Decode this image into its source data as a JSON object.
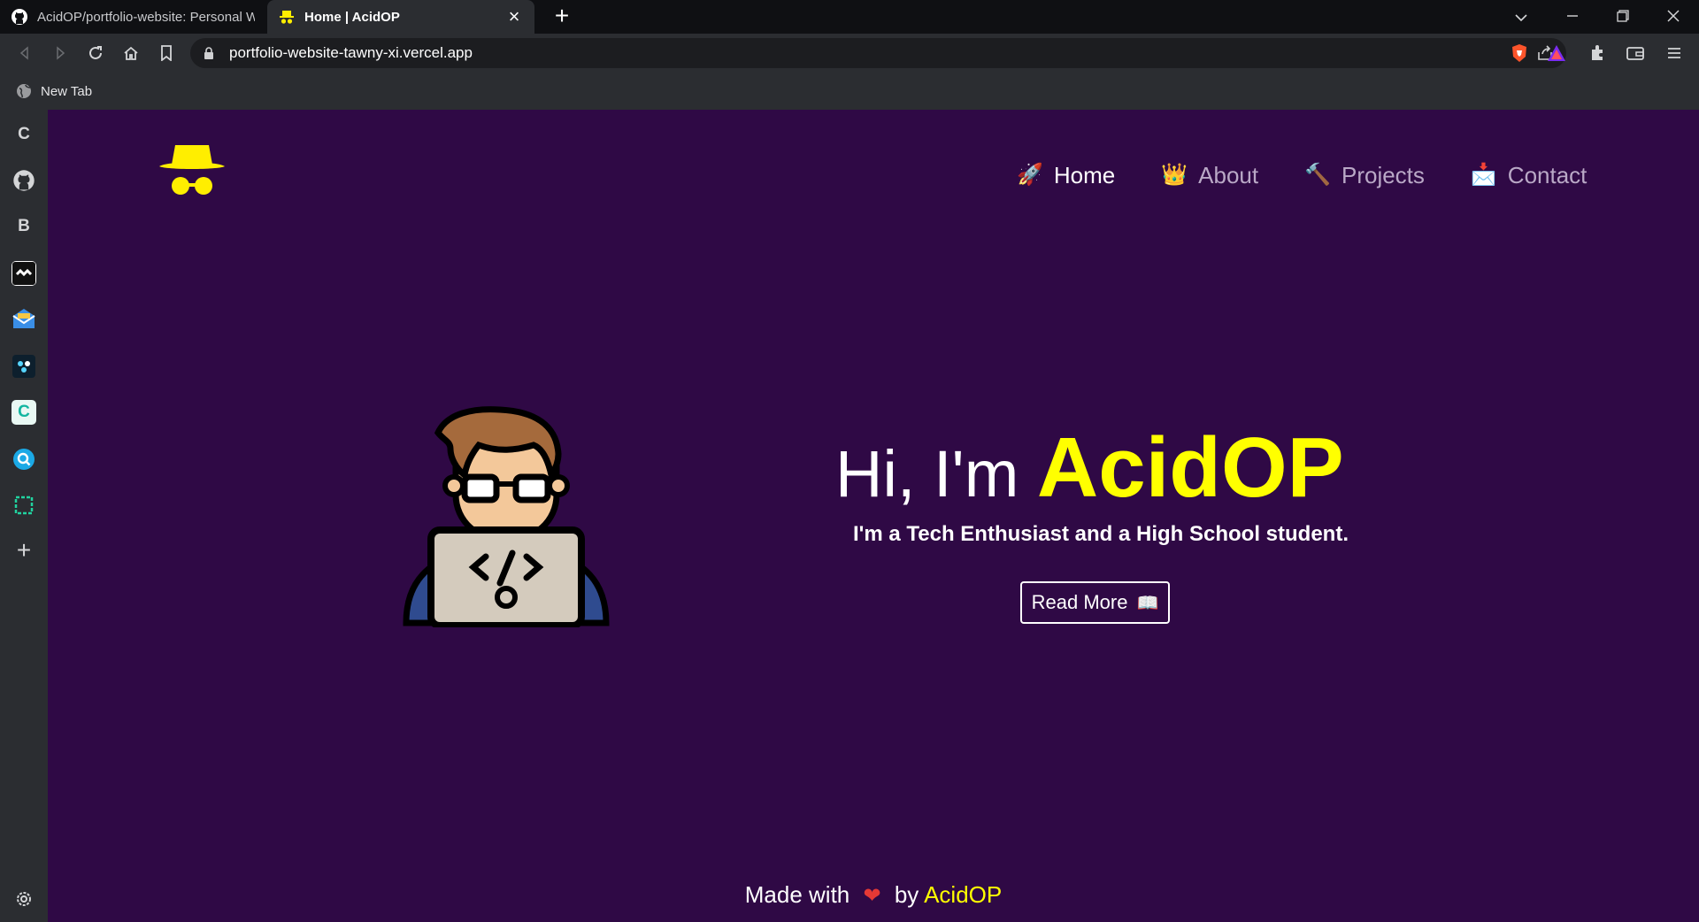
{
  "browser": {
    "tabs": [
      {
        "title": "AcidOP/portfolio-website: Personal W",
        "icon": "github-icon",
        "active": false
      },
      {
        "title": "Home | AcidOP",
        "icon": "spy-hat-icon",
        "active": true
      }
    ],
    "new_tab_label": "+",
    "window_controls": [
      "chevron-down-icon",
      "minimize-icon",
      "restore-icon",
      "close-icon"
    ],
    "address_bar": {
      "url": "portfolio-website-tawny-xi.vercel.app"
    },
    "bookmarks": [
      {
        "label": "New Tab"
      }
    ],
    "sidebar_icons": [
      "c-icon",
      "github-icon",
      "b-icon",
      "link-icon",
      "mail-icon",
      "puzzle-icon",
      "c-app-icon",
      "search-app-icon",
      "crop-icon",
      "plus-icon",
      "settings-icon"
    ],
    "colors": {
      "tabstrip": "#0f1013",
      "toolbar": "#2b2d31",
      "omnibox": "#1c1d20"
    }
  },
  "site": {
    "nav": [
      {
        "emoji": "🚀",
        "label": "Home",
        "active": true
      },
      {
        "emoji": "👑",
        "label": "About",
        "active": false
      },
      {
        "emoji": "🔨",
        "label": "Projects",
        "active": false
      },
      {
        "emoji": "📩",
        "label": "Contact",
        "active": false
      }
    ],
    "hero": {
      "greeting": "Hi, I'm",
      "name": "AcidOP",
      "subtitle": "I'm a Tech Enthusiast and a High School student.",
      "button_label": "Read More",
      "button_emoji": "📖"
    },
    "footer": {
      "made_with": "Made with",
      "heart": "❤",
      "by": "by",
      "brand": "AcidOP"
    },
    "colors": {
      "background": "#2f0945",
      "accent": "#ffff00",
      "text": "#ffffff"
    }
  }
}
